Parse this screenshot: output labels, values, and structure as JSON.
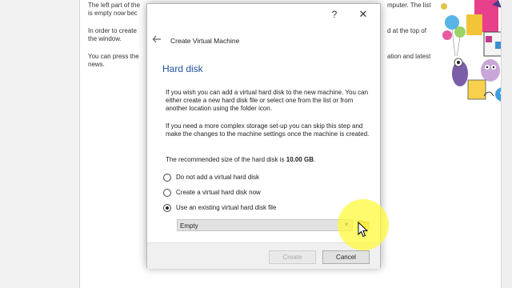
{
  "background": {
    "welcome_lines": {
      "p1_left_1": "The left part of the",
      "p1_left_2": "is empty now bec",
      "p1_right_1": "mputer. The list",
      "p2_left_1": "In order to create",
      "p2_left_2": "the window.",
      "p2_right_1": "d at the top of",
      "p3_left_1": "You can press the",
      "p3_left_2": "news.",
      "p3_right_1": "ation and latest"
    }
  },
  "dialog": {
    "help_icon": "?",
    "close_icon": "✕",
    "wizard_title": "Create Virtual Machine",
    "page_title": "Hard disk",
    "intro_text": "If you wish you can add a virtual hard disk to the new machine. You can either create a new hard disk file or select one from the list or from another location using the folder icon.",
    "complex_text": "If you need a more complex storage set-up you can skip this step and make the changes to the machine settings once the machine is created.",
    "recommended_prefix": "The recommended size of the hard disk is ",
    "recommended_value": "10.00 GB",
    "recommended_suffix": ".",
    "options": [
      {
        "label": "Do not add a virtual hard disk",
        "selected": false
      },
      {
        "label": "Create a virtual hard disk now",
        "selected": false
      },
      {
        "label": "Use an existing virtual hard disk file",
        "selected": true
      }
    ],
    "disk_combo_value": "Empty",
    "create_button": "Create",
    "cancel_button": "Cancel"
  },
  "icons": {
    "back": "arrow-left-icon",
    "folder": "folder-icon",
    "combo_arrow": "chevron-down-icon"
  },
  "colors": {
    "page_title": "#1f4e9d",
    "cursor_highlight": "#fffa3c"
  }
}
